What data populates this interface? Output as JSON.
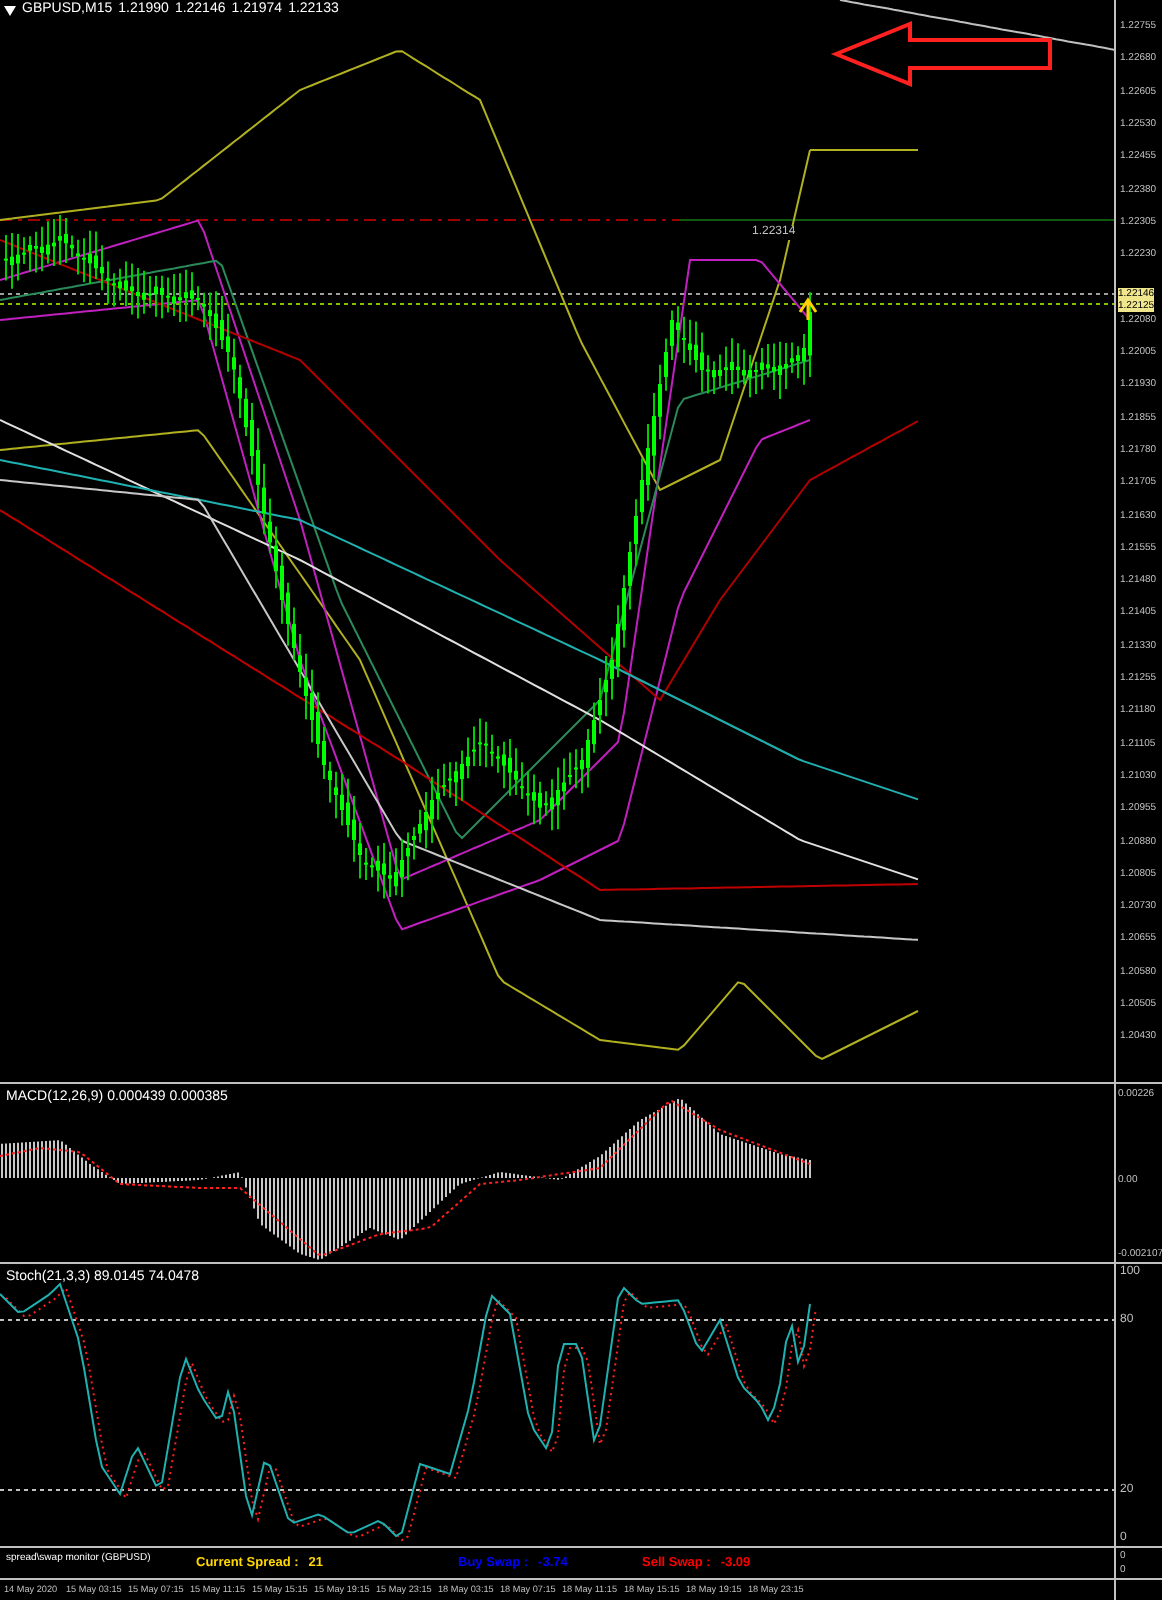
{
  "header": {
    "symbol": "GBPUSD,M15",
    "values": [
      "1.21990",
      "1.22146",
      "1.21974",
      "1.22133"
    ]
  },
  "price_axis": [
    "1.22755",
    "1.22680",
    "1.22605",
    "1.22530",
    "1.22455",
    "1.22380",
    "1.22305",
    "1.22230",
    "1.22080",
    "1.22005",
    "1.21930",
    "1.21855",
    "1.21780",
    "1.21705",
    "1.21630",
    "1.21555",
    "1.21480",
    "1.21405",
    "1.21330",
    "1.21255",
    "1.21180",
    "1.21105",
    "1.21030",
    "1.20955",
    "1.20880",
    "1.20805",
    "1.20730",
    "1.20655",
    "1.20580",
    "1.20505",
    "1.20430"
  ],
  "price_tags": [
    "1.22146",
    "1.22125"
  ],
  "line_label": "1.22314",
  "macd": {
    "title": "MACD(12,26,9) 0.000439 0.000385",
    "axis": [
      "0.00226",
      "0.00",
      "-0.002107"
    ]
  },
  "stoch": {
    "title": "Stoch(21,3,3) 89.0145 74.0478",
    "axis": [
      "100",
      "80",
      "20",
      "0"
    ]
  },
  "monitor": {
    "title": "spread\\swap monitor (GBPUSD)",
    "spread_label": "Current Spread :",
    "spread": "21",
    "buy_label": "Buy Swap :",
    "buy": "-3.74",
    "sell_label": "Sell Swap :",
    "sell": "-3.09",
    "axis": [
      "0",
      "0"
    ]
  },
  "time_axis": [
    "14 May 2020",
    "15 May 03:15",
    "15 May 07:15",
    "15 May 11:15",
    "15 May 15:15",
    "15 May 19:15",
    "15 May 23:15",
    "18 May 03:15",
    "18 May 07:15",
    "18 May 11:15",
    "18 May 15:15",
    "18 May 19:15",
    "18 May 23:15"
  ]
}
